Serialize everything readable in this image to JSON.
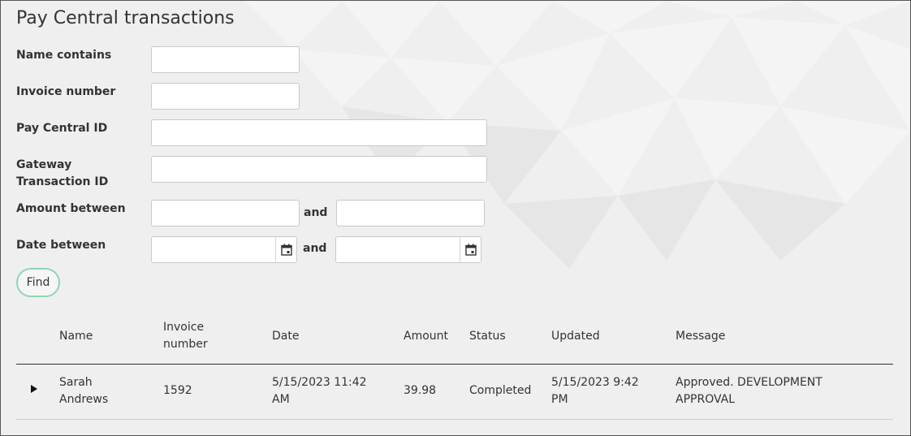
{
  "page": {
    "title": "Pay Central transactions"
  },
  "filters": {
    "name_label": "Name contains",
    "invoice_label": "Invoice number",
    "paycentral_id_label": "Pay Central ID",
    "gateway_label": "Gateway Transaction ID",
    "amount_label": "Amount between",
    "date_label": "Date between",
    "and_label": "and",
    "name_value": "",
    "invoice_value": "",
    "paycentral_id_value": "",
    "gateway_value": "",
    "amount_from": "",
    "amount_to": "",
    "date_from": "",
    "date_to": ""
  },
  "find_button": "Find",
  "table": {
    "columns": [
      "Name",
      "Invoice number",
      "Date",
      "Amount",
      "Status",
      "Updated",
      "Message"
    ],
    "rows": [
      {
        "name": "Sarah Andrews",
        "invoice": "1592",
        "date": "5/15/2023 11:42 AM",
        "amount": "39.98",
        "status": "Completed",
        "updated": "5/15/2023 9:42 PM",
        "message": "Approved. DEVELOPMENT APPROVAL"
      }
    ]
  },
  "icons": {
    "calendar": "calendar-icon",
    "expand": "triangle-right-icon"
  },
  "colors": {
    "background": "#efefef",
    "find_border": "#8fd6b4",
    "text": "#333333"
  }
}
